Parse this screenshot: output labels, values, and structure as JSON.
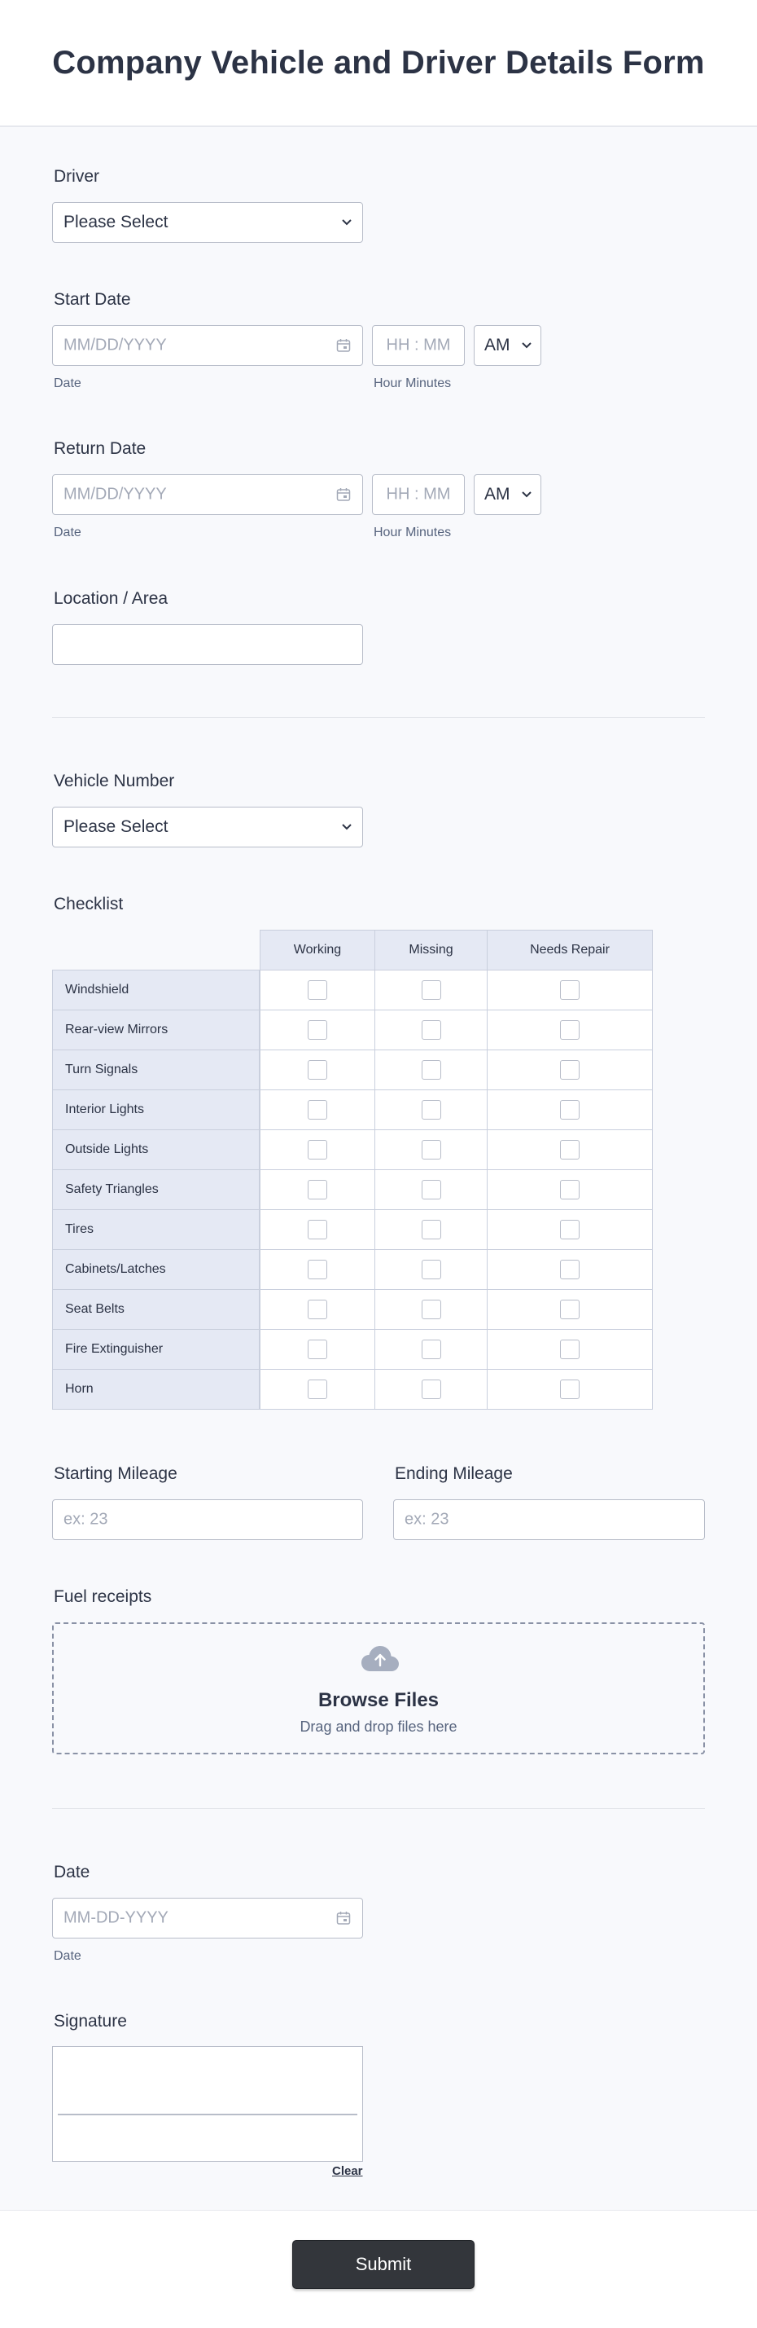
{
  "form": {
    "title": "Company Vehicle and Driver Details Form"
  },
  "driver": {
    "label": "Driver",
    "selected": "Please Select"
  },
  "start_date": {
    "label": "Start Date",
    "date_placeholder": "MM/DD/YYYY",
    "date_sublabel": "Date",
    "time_placeholder": "HH : MM",
    "time_sublabel": "Hour Minutes",
    "ampm": "AM"
  },
  "return_date": {
    "label": "Return Date",
    "date_placeholder": "MM/DD/YYYY",
    "date_sublabel": "Date",
    "time_placeholder": "HH : MM",
    "time_sublabel": "Hour Minutes",
    "ampm": "AM"
  },
  "location": {
    "label": "Location / Area",
    "value": ""
  },
  "vehicle_number": {
    "label": "Vehicle Number",
    "selected": "Please Select"
  },
  "checklist": {
    "label": "Checklist",
    "columns": [
      "Working",
      "Missing",
      "Needs Repair"
    ],
    "rows": [
      "Windshield",
      "Rear-view Mirrors",
      "Turn Signals",
      "Interior Lights",
      "Outside Lights",
      "Safety Triangles",
      "Tires",
      "Cabinets/Latches",
      "Seat Belts",
      "Fire Extinguisher",
      "Horn"
    ]
  },
  "starting_mileage": {
    "label": "Starting Mileage",
    "placeholder": "ex: 23"
  },
  "ending_mileage": {
    "label": "Ending Mileage",
    "placeholder": "ex: 23"
  },
  "fuel_receipts": {
    "label": "Fuel receipts",
    "browse_label": "Browse Files",
    "drag_label": "Drag and drop files here",
    "icon": "cloud-upload-icon"
  },
  "date": {
    "label": "Date",
    "placeholder": "MM-DD-YYYY",
    "sublabel": "Date"
  },
  "signature": {
    "label": "Signature",
    "clear_label": "Clear"
  },
  "submit": {
    "label": "Submit"
  },
  "colors": {
    "text": "#2c3345",
    "matrix_header": "#e5e9f4",
    "submit": "#33363b"
  }
}
